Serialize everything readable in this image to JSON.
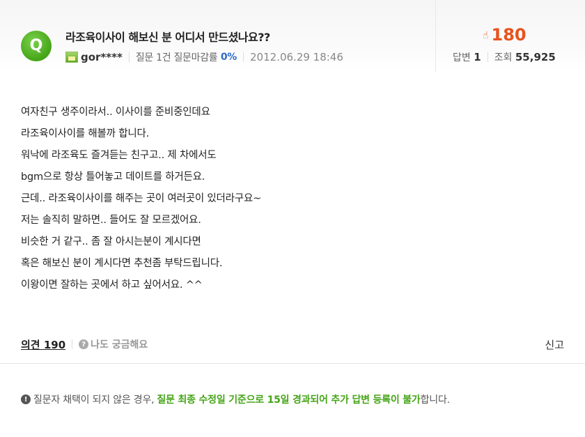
{
  "question": {
    "badge": "Q",
    "title": "라조육이사이 해보신 분 어디서 만드셨나요??",
    "user": "gor****",
    "stats_text": "질문 1건 질문마감률",
    "close_rate": "0%",
    "date": "2012.06.29 18:46",
    "likes": "180",
    "answers_label": "답변",
    "answers": "1",
    "views_label": "조회",
    "views": "55,925"
  },
  "body_lines": [
    "여자친구 생주이라서.. 이사이를 준비중인데요",
    "라조육이사이를 해볼까 합니다.",
    "워낙에 라조육도 즐겨듣는 친구고.. 제 차에서도",
    "bgm으로 항상 틀어놓고 데이트를 하거든요.",
    "근데.. 라조육이사이를 해주는 곳이 여러곳이 있더라구요~",
    "저는 솔직히 말하면.. 들어도 잘 모르겠어요.",
    "비슷한 거 같구.. 좀 잘 아시는분이 계시다면",
    "혹은 해보신 분이 계시다면 추천좀 부탁드립니다.",
    "이왕이면 잘하는 곳에서 하고 싶어서요. ^^"
  ],
  "actions": {
    "opinion": "의견 190",
    "curious": "나도 궁금해요",
    "report": "신고"
  },
  "notice": {
    "prefix": "질문자 채택이 되지 않은 경우,",
    "highlight": "질문 최종 수정일 기준으로 15일 경과되어 추가 답변 등록이 불가",
    "suffix": "합니다."
  },
  "colors": {
    "brand_green": "#45a417",
    "likes_orange": "#e8521e",
    "rate_blue": "#2e6ac7"
  }
}
